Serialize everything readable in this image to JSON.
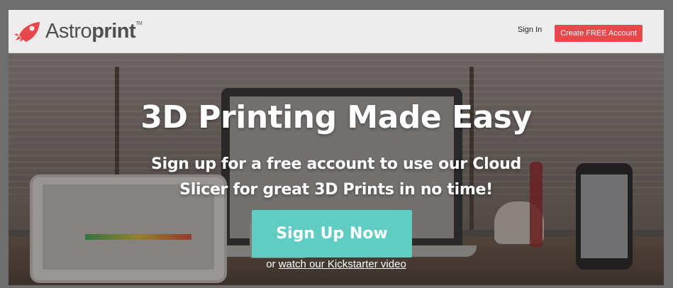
{
  "navbar": {
    "logo_text_light": "Astro",
    "logo_text_bold": "print",
    "logo_tm": "TM",
    "logo_icon": "rocket-icon",
    "signin_label": "Sign In",
    "create_account_label": "Create FREE Account"
  },
  "hero": {
    "title": "3D Printing Made Easy",
    "subtitle_line1": "Sign up for a free account to use our Cloud",
    "subtitle_line2": "Slicer for great 3D Prints in no time!",
    "signup_label": "Sign Up Now",
    "kickstarter_prefix": "or",
    "kickstarter_link": "watch our Kickstarter video"
  },
  "colors": {
    "accent_red": "#e8484b",
    "signup_teal": "#5fcdc1",
    "navbar_bg": "#ededed"
  }
}
